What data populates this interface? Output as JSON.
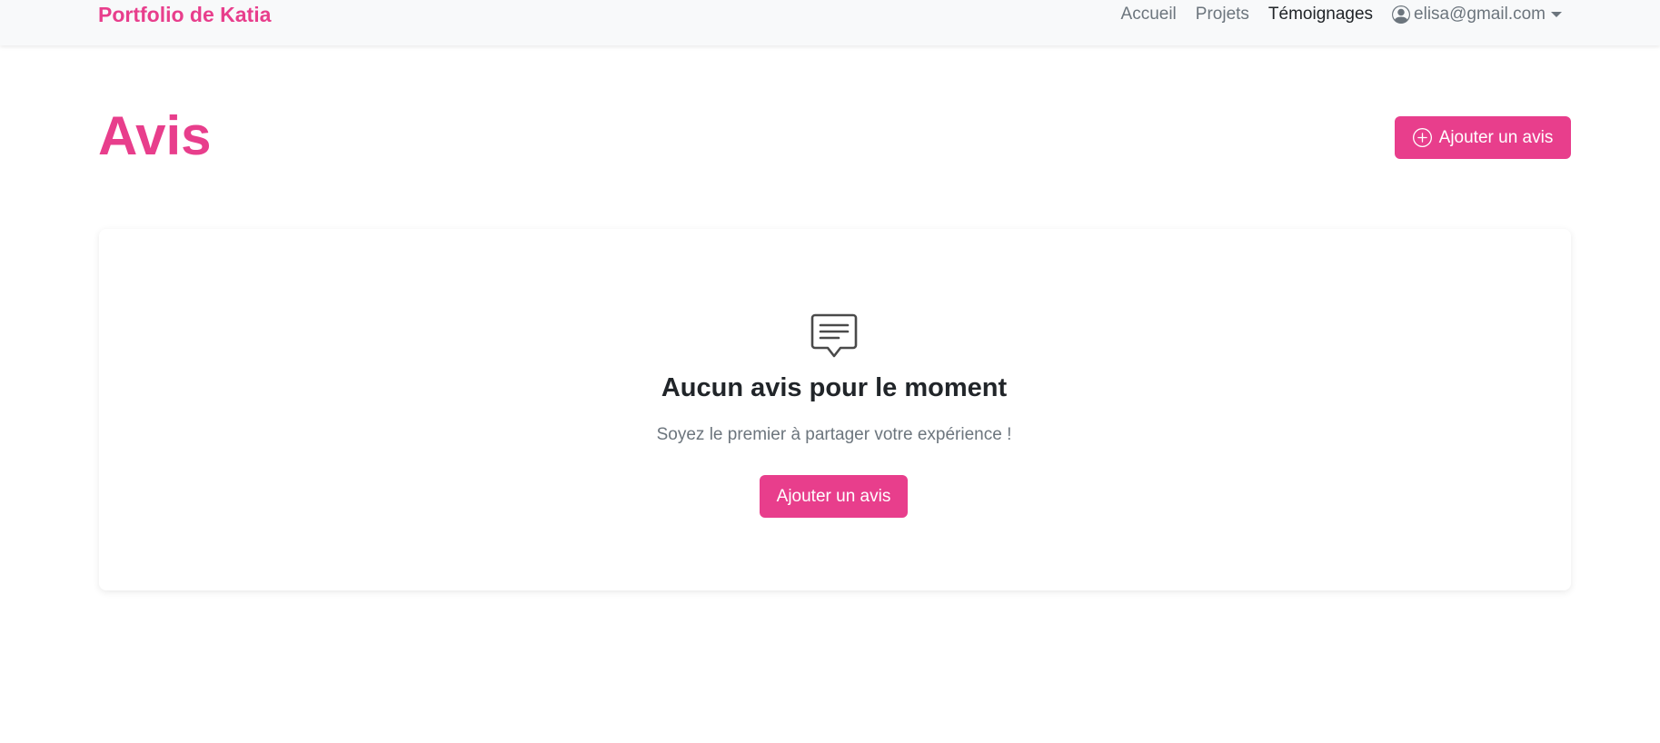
{
  "nav": {
    "brand": "Portfolio de Katia",
    "links": [
      "Accueil",
      "Projets",
      "Témoignages"
    ],
    "user_email": "elisa@gmail.com"
  },
  "page": {
    "title": "Avis",
    "add_button_label": "Ajouter un avis"
  },
  "empty_state": {
    "title": "Aucun avis pour le moment",
    "subtitle": "Soyez le premier à partager votre expérience !",
    "button_label": "Ajouter un avis"
  },
  "colors": {
    "accent": "#e83e8c",
    "navbar_bg": "#f8f9fa",
    "text_muted": "#6c757d",
    "text_dark": "#212529"
  },
  "icons": {
    "user": "person-circle-icon",
    "add": "plus-circle-icon",
    "empty": "chat-left-text-icon"
  }
}
